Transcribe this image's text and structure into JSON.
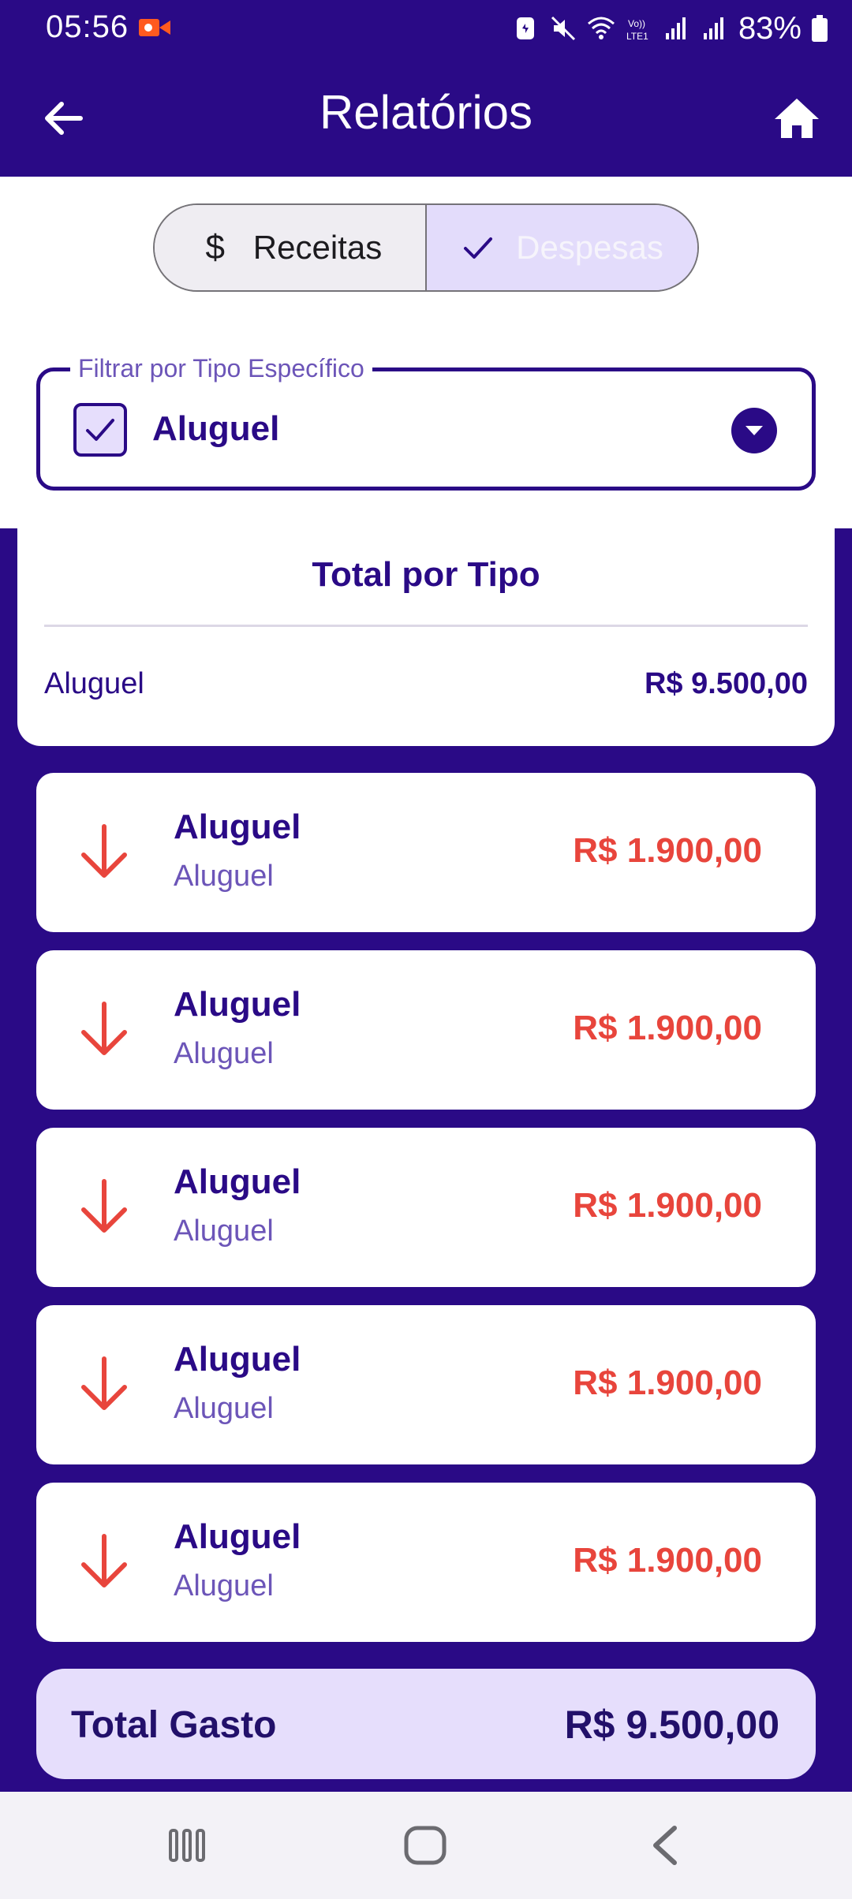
{
  "status_bar": {
    "time": "05:56",
    "battery": "83%",
    "icons": [
      "recording-icon",
      "data-saver-icon",
      "mute-icon",
      "wifi-icon",
      "volte-icon",
      "signal-icon",
      "battery-icon"
    ]
  },
  "app_bar": {
    "title": "Relatórios",
    "icons": [
      "back-arrow-icon",
      "home-icon"
    ]
  },
  "segmented_control": {
    "options": [
      {
        "label": "Receitas",
        "icon": "dollar-icon",
        "selected": false
      },
      {
        "label": "Despesas",
        "icon": "check-icon",
        "selected": true
      }
    ]
  },
  "filter": {
    "label": "Filtrar por Tipo Específico",
    "value": "Aluguel",
    "checked": true
  },
  "summary": {
    "title": "Total por Tipo",
    "rows": [
      {
        "label": "Aluguel",
        "amount": "R$ 9.500,00"
      }
    ]
  },
  "transactions": [
    {
      "title": "Aluguel",
      "subtitle": "Aluguel",
      "amount": "R$ 1.900,00",
      "icon": "arrow-down-icon"
    },
    {
      "title": "Aluguel",
      "subtitle": "Aluguel",
      "amount": "R$ 1.900,00",
      "icon": "arrow-down-icon"
    },
    {
      "title": "Aluguel",
      "subtitle": "Aluguel",
      "amount": "R$ 1.900,00",
      "icon": "arrow-down-icon"
    },
    {
      "title": "Aluguel",
      "subtitle": "Aluguel",
      "amount": "R$ 1.900,00",
      "icon": "arrow-down-icon"
    },
    {
      "title": "Aluguel",
      "subtitle": "Aluguel",
      "amount": "R$ 1.900,00",
      "icon": "arrow-down-icon"
    }
  ],
  "total": {
    "label": "Total Gasto",
    "amount": "R$ 9.500,00"
  },
  "colors": {
    "primary": "#2a0a86",
    "expense": "#e8453c",
    "selected_segment": "#e3dcfb",
    "total_card": "#e6defc"
  },
  "nav_bar": {
    "icons": [
      "recents-icon",
      "home-nav-icon",
      "back-nav-icon"
    ]
  }
}
